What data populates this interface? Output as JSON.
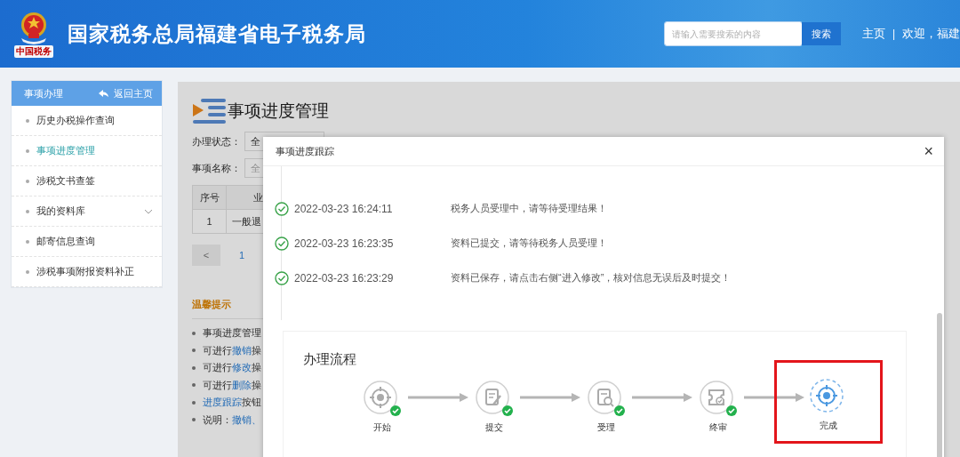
{
  "header": {
    "logo_text": "中国税务",
    "title": "国家税务总局福建省电子税务局",
    "search": {
      "placeholder": "请输入需要搜索的内容",
      "button": "搜索"
    },
    "nav": [
      {
        "label": "主页"
      },
      {
        "label": "欢迎，福建"
      }
    ],
    "separator": "|"
  },
  "sidebar": {
    "title": "事项办理",
    "back": "返回主页",
    "items": [
      {
        "label": "历史办税操作查询",
        "selected": false,
        "expandable": false
      },
      {
        "label": "事项进度管理",
        "selected": true,
        "expandable": false
      },
      {
        "label": "涉税文书查签",
        "selected": false,
        "expandable": false
      },
      {
        "label": "我的资料库",
        "selected": false,
        "expandable": true
      },
      {
        "label": "邮寄信息查询",
        "selected": false,
        "expandable": false
      },
      {
        "label": "涉税事项附报资料补正",
        "selected": false,
        "expandable": false
      }
    ]
  },
  "page": {
    "title": "事项进度管理",
    "filters": [
      {
        "label": "办理状态：",
        "value": "全"
      },
      {
        "label": "事项名称：",
        "placeholder": "全"
      }
    ],
    "table": {
      "columns": [
        "序号",
        "业"
      ],
      "rows": [
        [
          "1",
          "一般退"
        ]
      ]
    },
    "pagination": {
      "prev": "<",
      "pages": [
        {
          "label": "1",
          "selected": true
        }
      ]
    },
    "tips": {
      "title": "温馨提示",
      "items": [
        {
          "parts": [
            {
              "text": "事项进度管理",
              "link": false
            }
          ]
        },
        {
          "parts": [
            {
              "text": "可进行",
              "link": false
            },
            {
              "text": "撤销",
              "link": true
            },
            {
              "text": "操",
              "link": false
            }
          ]
        },
        {
          "parts": [
            {
              "text": "可进行",
              "link": false
            },
            {
              "text": "修改",
              "link": true
            },
            {
              "text": "操",
              "link": false
            }
          ]
        },
        {
          "parts": [
            {
              "text": "可进行",
              "link": false
            },
            {
              "text": "删除",
              "link": true
            },
            {
              "text": "操",
              "link": false
            }
          ]
        },
        {
          "parts": [
            {
              "text": "进度跟踪",
              "link": true
            },
            {
              "text": "按钮",
              "link": false
            }
          ]
        },
        {
          "parts": [
            {
              "text": "说明：",
              "link": false
            },
            {
              "text": "撤销、",
              "link": true
            }
          ]
        }
      ]
    }
  },
  "modal": {
    "title": "事项进度跟踪",
    "close": "×",
    "timeline": [
      {
        "time": "2022-03-23 16:24:11",
        "message": "税务人员受理中，请等待受理结果！"
      },
      {
        "time": "2022-03-23 16:23:35",
        "message": "资料已提交，请等待税务人员受理！"
      },
      {
        "time": "2022-03-23 16:23:29",
        "message": "资料已保存，请点击右侧“进入修改”，核对信息无误后及时提交！"
      }
    ],
    "flow": {
      "title": "办理流程",
      "steps": [
        {
          "label": "开始",
          "kind": "start",
          "done": true,
          "highlighted": false
        },
        {
          "label": "提交",
          "kind": "edit",
          "done": true,
          "highlighted": false
        },
        {
          "label": "受理",
          "kind": "review",
          "done": true,
          "highlighted": false
        },
        {
          "label": "终审",
          "kind": "final",
          "done": true,
          "highlighted": false
        },
        {
          "label": "完成",
          "kind": "end",
          "done": false,
          "highlighted": true
        }
      ]
    }
  }
}
